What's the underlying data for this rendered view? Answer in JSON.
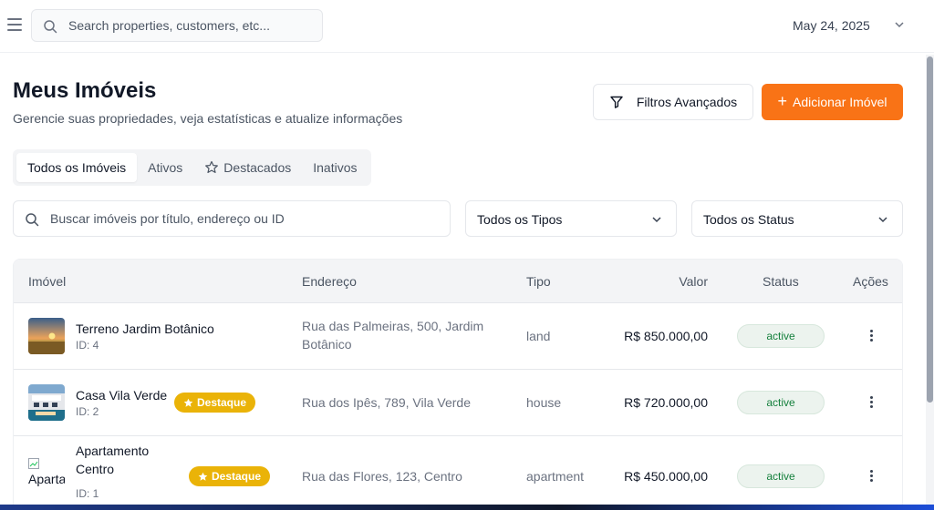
{
  "topbar": {
    "search_placeholder": "Search properties, customers, etc...",
    "date": "May 24, 2025"
  },
  "header": {
    "title": "Meus Imóveis",
    "subtitle": "Gerencie suas propriedades, veja estatísticas e atualize informações",
    "filters_button": "Filtros Avançados",
    "add_button": "Adicionar Imóvel"
  },
  "tabs": [
    {
      "label": "Todos os Imóveis",
      "active": true
    },
    {
      "label": "Ativos",
      "active": false
    },
    {
      "label": "Destacados",
      "active": false
    },
    {
      "label": "Inativos",
      "active": false
    }
  ],
  "filters": {
    "search_placeholder": "Buscar imóveis por título, endereço ou ID",
    "type_select": "Todos os Tipos",
    "status_select": "Todos os Status"
  },
  "table": {
    "headers": {
      "property": "Imóvel",
      "address": "Endereço",
      "type": "Tipo",
      "value": "Valor",
      "status": "Status",
      "actions": "Ações"
    },
    "rows": [
      {
        "title": "Terreno Jardim Botânico",
        "id": "ID: 4",
        "featured": false,
        "address": "Rua das Palmeiras, 500, Jardim Botânico",
        "type": "land",
        "value": "R$ 850.000,00",
        "status": "active"
      },
      {
        "title": "Casa Vila Verde",
        "id": "ID: 2",
        "featured": true,
        "badge": "Destaque",
        "address": "Rua dos Ipês, 789, Vila Verde",
        "type": "house",
        "value": "R$ 720.000,00",
        "status": "active"
      },
      {
        "title": "Apartamento Centro",
        "id": "ID: 1",
        "featured": true,
        "badge": "Destaque",
        "thumb_alt": "Aparta",
        "address": "Rua das Flores, 123, Centro",
        "type": "apartment",
        "value": "R$ 450.000,00",
        "status": "active"
      }
    ]
  },
  "colors": {
    "accent": "#f97316",
    "badge": "#eab308",
    "status_text": "#15803d"
  }
}
